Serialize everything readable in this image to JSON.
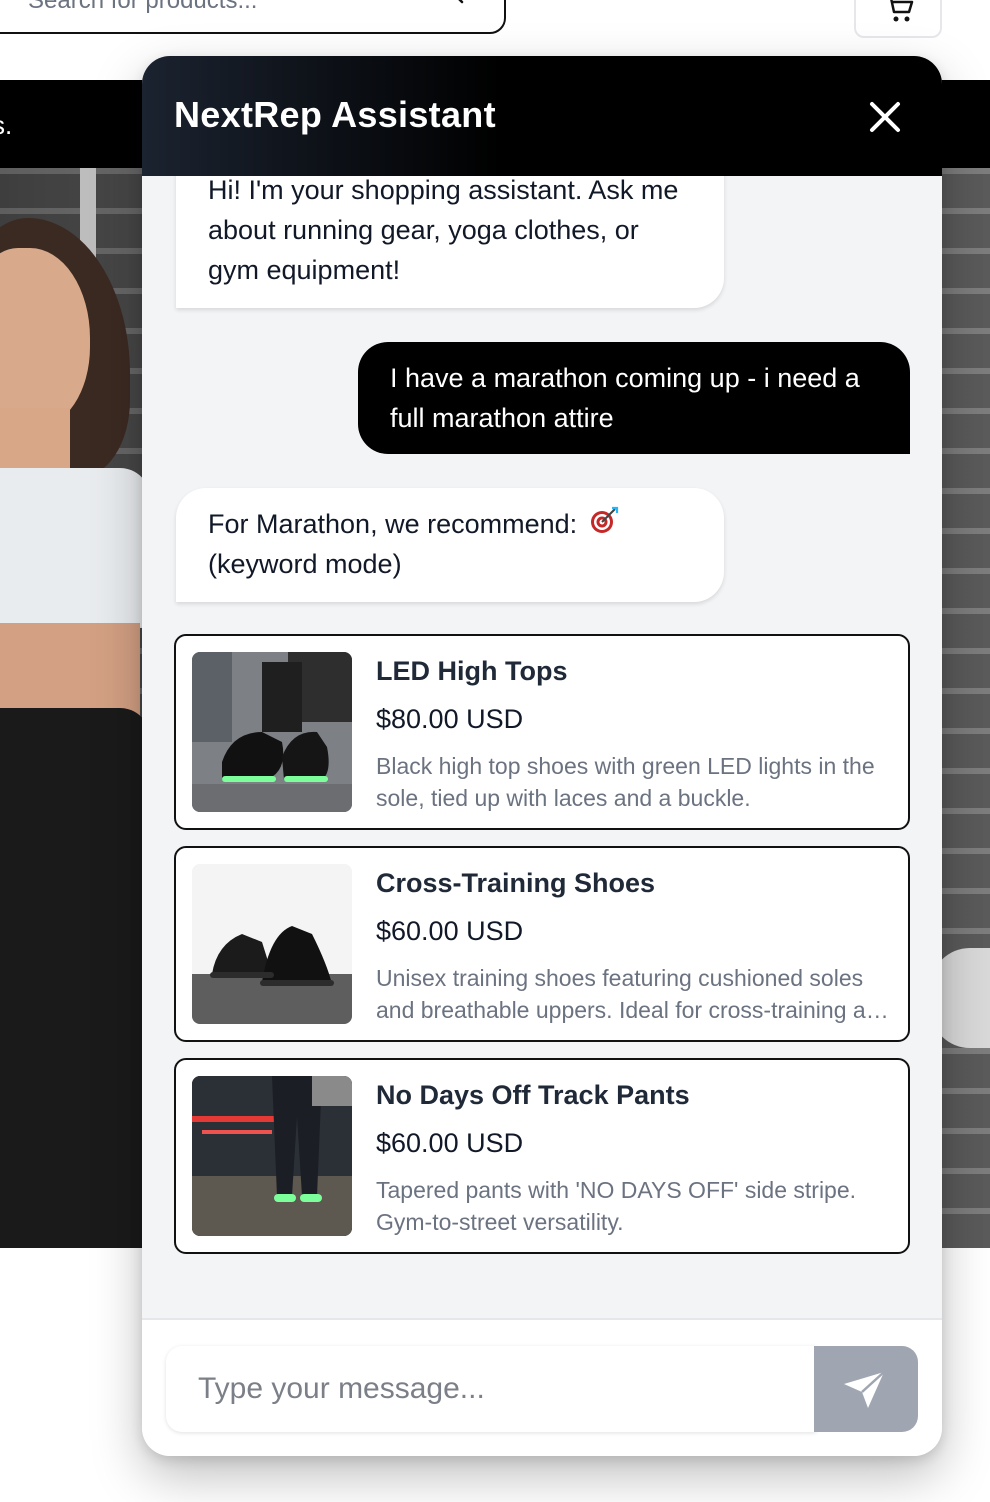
{
  "page": {
    "search": {
      "placeholder": "Search for products..."
    },
    "announcement": {
      "text": "s."
    }
  },
  "chat": {
    "title": "NextRep Assistant",
    "messages": {
      "greeting": "Hi! I'm your shopping assistant. Ask me about running gear, yoga clothes, or gym equipment!",
      "user": "I have a marathon coming up - i need a full marathon attire",
      "reply": "For Marathon, we recommend:",
      "reply_mode": "(keyword mode)"
    },
    "products": [
      {
        "name": "LED High Tops",
        "price": "$80.00 USD",
        "description": "Black high top shoes with green LED lights in the sole, tied up with laces and a buckle."
      },
      {
        "name": "Cross-Training Shoes",
        "price": "$60.00 USD",
        "description": "Unisex training shoes featuring cushioned soles and breathable uppers. Ideal for cross-training and gym workouts."
      },
      {
        "name": "No Days Off Track Pants",
        "price": "$60.00 USD",
        "description": "Tapered pants with 'NO DAYS OFF' side stripe. Gym-to-street versatility."
      }
    ],
    "input": {
      "placeholder": "Type your message..."
    }
  },
  "colors": {
    "header_bg": "#000000",
    "user_bubble": "#000000",
    "send_button": "#a0a6b1",
    "chat_bg": "#f3f4f6"
  },
  "icons": [
    "search-icon",
    "cart-icon",
    "close-icon",
    "target-icon",
    "send-icon"
  ]
}
